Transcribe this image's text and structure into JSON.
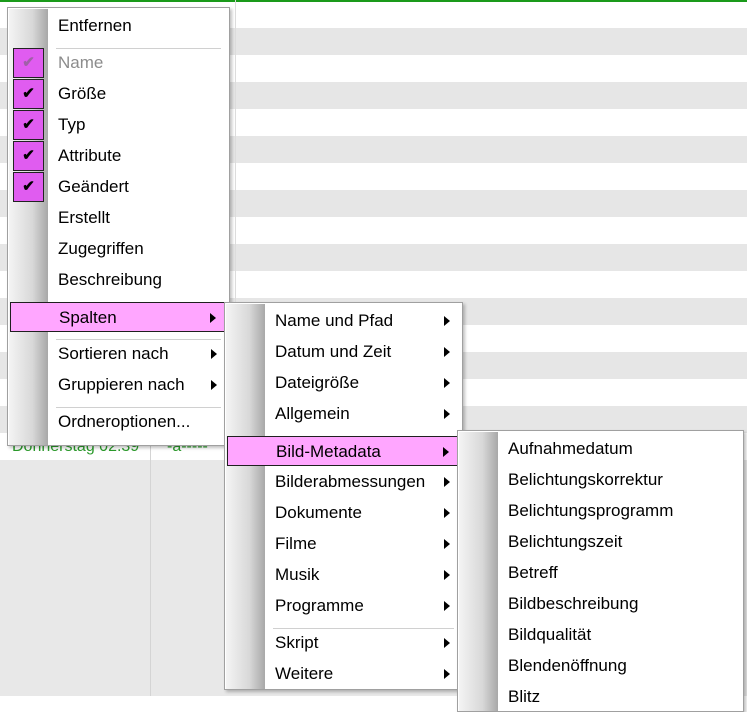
{
  "background_row": {
    "date": "Donnerstag  02.39",
    "attributes": "-a-----"
  },
  "colors": {
    "highlight": "#ffa6ff",
    "checkbox": "#e05cf0",
    "row_text": "#2a9a2a"
  },
  "menus": [
    {
      "id": "context-menu",
      "items": [
        {
          "label": "Entfernen"
        },
        {
          "sep": true
        },
        {
          "label": "Name",
          "checked": true,
          "disabled": true
        },
        {
          "label": "Größe",
          "checked": true
        },
        {
          "label": "Typ",
          "checked": true
        },
        {
          "label": "Attribute",
          "checked": true
        },
        {
          "label": "Geändert",
          "checked": true
        },
        {
          "label": "Erstellt"
        },
        {
          "label": "Zugegriffen"
        },
        {
          "label": "Beschreibung"
        },
        {
          "sep": true
        },
        {
          "label": "Spalten",
          "submenu": true,
          "highlighted": true
        },
        {
          "sep": true
        },
        {
          "label": "Sortieren nach",
          "submenu": true
        },
        {
          "label": "Gruppieren nach",
          "submenu": true
        },
        {
          "sep": true
        },
        {
          "label": "Ordneroptionen..."
        }
      ]
    },
    {
      "id": "spalten-submenu",
      "items": [
        {
          "label": "Name und Pfad",
          "submenu": true
        },
        {
          "label": "Datum und Zeit",
          "submenu": true
        },
        {
          "label": "Dateigröße",
          "submenu": true
        },
        {
          "label": "Allgemein",
          "submenu": true
        },
        {
          "sep": true
        },
        {
          "label": "Bild-Metadata",
          "submenu": true,
          "highlighted": true
        },
        {
          "label": "Bilderabmessungen",
          "submenu": true
        },
        {
          "label": "Dokumente",
          "submenu": true
        },
        {
          "label": "Filme",
          "submenu": true
        },
        {
          "label": "Musik",
          "submenu": true
        },
        {
          "label": "Programme",
          "submenu": true
        },
        {
          "sep": true
        },
        {
          "label": "Skript",
          "submenu": true
        },
        {
          "label": "Weitere",
          "submenu": true
        }
      ]
    },
    {
      "id": "bild-metadata-submenu",
      "items": [
        {
          "label": "Aufnahmedatum"
        },
        {
          "label": "Belichtungskorrektur"
        },
        {
          "label": "Belichtungsprogramm"
        },
        {
          "label": "Belichtungszeit"
        },
        {
          "label": "Betreff"
        },
        {
          "label": "Bildbeschreibung"
        },
        {
          "label": "Bildqualität"
        },
        {
          "label": "Blendenöffnung"
        },
        {
          "label": "Blitz"
        }
      ]
    }
  ]
}
